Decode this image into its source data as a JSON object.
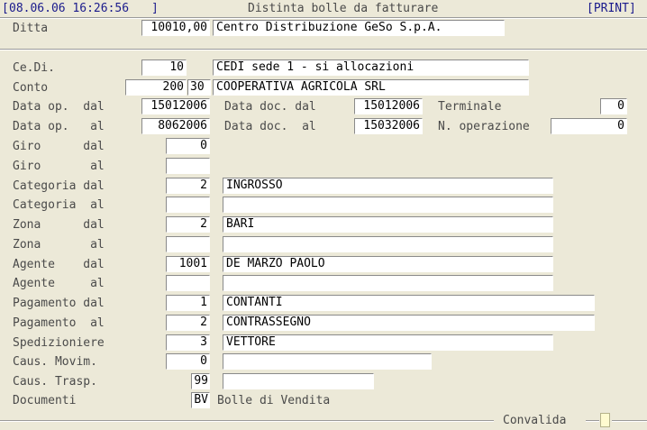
{
  "header": {
    "datetime": "08.06.06 16:26:56",
    "bracket_open": "[",
    "bracket_close": "]",
    "title": "Distinta bolle da fatturare",
    "print_button": "[PRINT]"
  },
  "ditta": {
    "label": "Ditta",
    "code": "10010,00",
    "description": "Centro Distribuzione GeSo S.p.A."
  },
  "cedi": {
    "label": "Ce.Di.",
    "code": "10",
    "description": "CEDI sede 1 - si allocazioni"
  },
  "conto": {
    "label": "Conto",
    "code": "200",
    "sub_code": "30",
    "description": "COOPERATIVA AGRICOLA SRL"
  },
  "data_op_dal": {
    "label": "Data op.  dal",
    "value": "15012006"
  },
  "data_op_al": {
    "label": "Data op.   al",
    "value": "8062006"
  },
  "data_doc_dal": {
    "label": "Data doc. dal",
    "value": "15012006"
  },
  "data_doc_al": {
    "label": "Data doc.  al",
    "value": "15032006"
  },
  "terminale": {
    "label": "Terminale",
    "value": "0"
  },
  "n_operazione": {
    "label": "N. operazione",
    "value": "0"
  },
  "giro_dal": {
    "label": "Giro      dal",
    "value": "0"
  },
  "giro_al": {
    "label": "Giro       al",
    "value": ""
  },
  "categoria_dal": {
    "label": "Categoria dal",
    "code": "2",
    "description": "INGROSSO"
  },
  "categoria_al": {
    "label": "Categoria  al",
    "code": "",
    "description": ""
  },
  "zona_dal": {
    "label": "Zona      dal",
    "code": "2",
    "description": "BARI"
  },
  "zona_al": {
    "label": "Zona       al",
    "code": "",
    "description": ""
  },
  "agente_dal": {
    "label": "Agente    dal",
    "code": "1001",
    "description": "DE MARZO PAOLO"
  },
  "agente_al": {
    "label": "Agente     al",
    "code": "",
    "description": ""
  },
  "pagamento_dal": {
    "label": "Pagamento dal",
    "code": "1",
    "description": "CONTANTI"
  },
  "pagamento_al": {
    "label": "Pagamento  al",
    "code": "2",
    "description": "CONTRASSEGNO"
  },
  "spedizioniere": {
    "label": "Spedizioniere",
    "code": "3",
    "description": "VETTORE"
  },
  "caus_movim": {
    "label": "Caus. Movim.",
    "code": "0",
    "description": ""
  },
  "caus_trasp": {
    "label": "Caus. Trasp.",
    "code": "99",
    "description": ""
  },
  "documenti": {
    "label": "Documenti",
    "code": "BV",
    "description": "Bolle di Vendita"
  },
  "footer": {
    "convalida_label": "Convalida"
  },
  "colors": {
    "background": "#ece9d8",
    "field": "#ffffff",
    "header_text": "#1a1a8c",
    "label_text": "#4a4a4a"
  }
}
